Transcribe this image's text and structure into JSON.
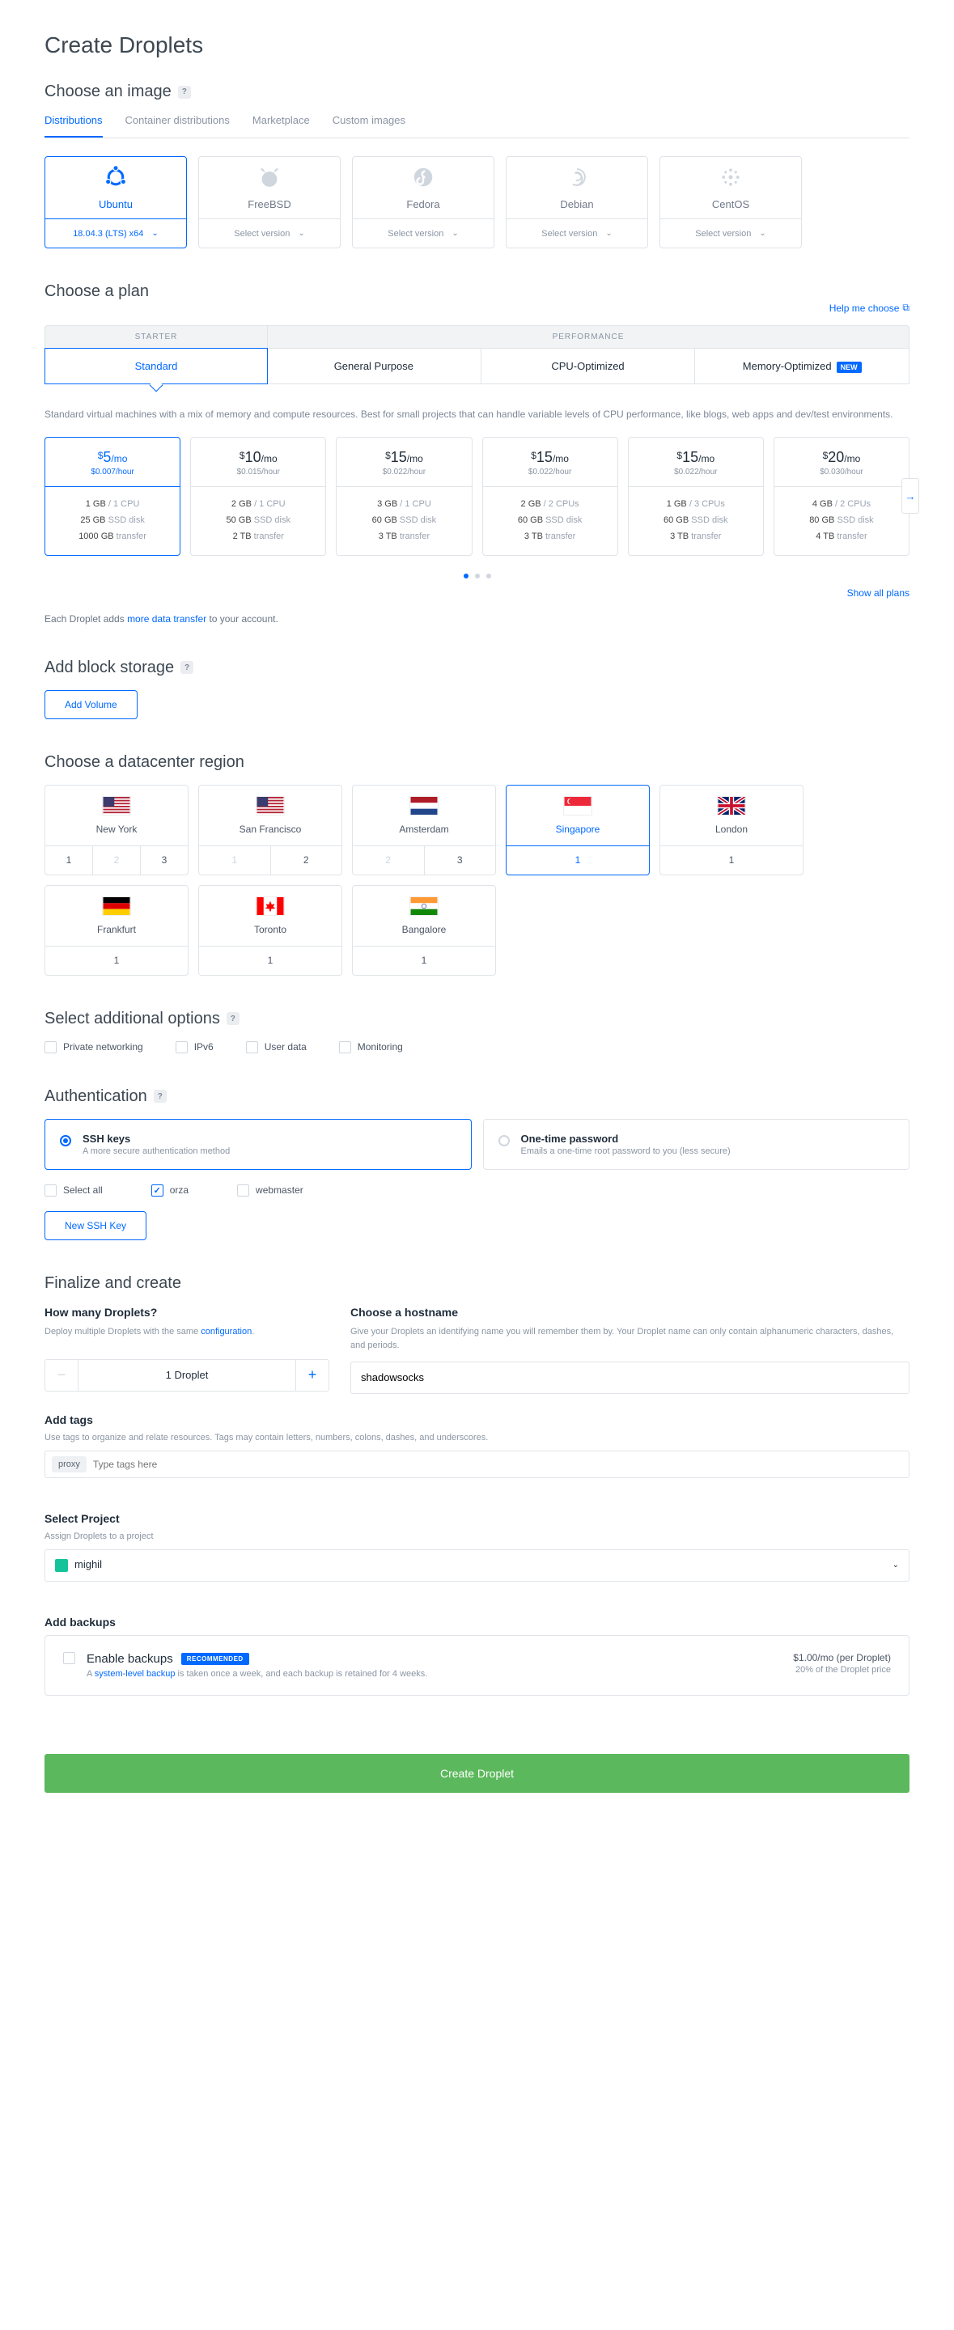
{
  "page_title": "Create Droplets",
  "image": {
    "heading": "Choose an image",
    "tabs": [
      "Distributions",
      "Container distributions",
      "Marketplace",
      "Custom images"
    ],
    "active_tab": 0,
    "distros": [
      {
        "name": "Ubuntu",
        "version": "18.04.3 (LTS) x64",
        "selected": true,
        "color": "#0069ff"
      },
      {
        "name": "FreeBSD",
        "version": "Select version",
        "selected": false,
        "color": "#cfd6de"
      },
      {
        "name": "Fedora",
        "version": "Select version",
        "selected": false,
        "color": "#cfd6de"
      },
      {
        "name": "Debian",
        "version": "Select version",
        "selected": false,
        "color": "#cfd6de"
      },
      {
        "name": "CentOS",
        "version": "Select version",
        "selected": false,
        "color": "#cfd6de"
      }
    ]
  },
  "plan": {
    "heading": "Choose a plan",
    "help_link": "Help me choose",
    "group_starter": "STARTER",
    "group_perf": "PERFORMANCE",
    "tabs": [
      "Standard",
      "General Purpose",
      "CPU-Optimized",
      "Memory-Optimized"
    ],
    "new_on": 3,
    "active_tab": 0,
    "desc": "Standard virtual machines with a mix of memory and compute resources. Best for small projects that can handle variable levels of CPU performance, like blogs, web apps and dev/test environments.",
    "prices": [
      {
        "mo": "5",
        "hr": "$0.007/hour",
        "ram": "1 GB",
        "cpu": "1 CPU",
        "disk": "25 GB",
        "xfer": "1000 GB",
        "selected": true
      },
      {
        "mo": "10",
        "hr": "$0.015/hour",
        "ram": "2 GB",
        "cpu": "1 CPU",
        "disk": "50 GB",
        "xfer": "2 TB",
        "selected": false
      },
      {
        "mo": "15",
        "hr": "$0.022/hour",
        "ram": "3 GB",
        "cpu": "1 CPU",
        "disk": "60 GB",
        "xfer": "3 TB",
        "selected": false
      },
      {
        "mo": "15",
        "hr": "$0.022/hour",
        "ram": "2 GB",
        "cpu": "2 CPUs",
        "disk": "60 GB",
        "xfer": "3 TB",
        "selected": false
      },
      {
        "mo": "15",
        "hr": "$0.022/hour",
        "ram": "1 GB",
        "cpu": "3 CPUs",
        "disk": "60 GB",
        "xfer": "3 TB",
        "selected": false
      },
      {
        "mo": "20",
        "hr": "$0.030/hour",
        "ram": "4 GB",
        "cpu": "2 CPUs",
        "disk": "80 GB",
        "xfer": "4 TB",
        "selected": false
      }
    ],
    "spec_labels": {
      "disk": "SSD disk",
      "xfer": "transfer",
      "mo_suffix": "/mo"
    },
    "show_all": "Show all plans",
    "note_prefix": "Each Droplet adds ",
    "note_link": "more data transfer",
    "note_suffix": " to your account."
  },
  "block": {
    "heading": "Add block storage",
    "button": "Add Volume"
  },
  "dc": {
    "heading": "Choose a datacenter region",
    "regions": [
      {
        "name": "New York",
        "flag": "us",
        "nums": [
          {
            "n": "1",
            "en": true
          },
          {
            "n": "2",
            "en": false
          },
          {
            "n": "3",
            "en": true
          }
        ],
        "selected": false
      },
      {
        "name": "San Francisco",
        "flag": "us",
        "nums": [
          {
            "n": "1",
            "en": false
          },
          {
            "n": "2",
            "en": true
          }
        ],
        "selected": false
      },
      {
        "name": "Amsterdam",
        "flag": "nl",
        "nums": [
          {
            "n": "2",
            "en": false
          },
          {
            "n": "3",
            "en": true
          }
        ],
        "selected": false
      },
      {
        "name": "Singapore",
        "flag": "sg",
        "nums": [
          {
            "n": "1",
            "en": true
          }
        ],
        "selected": true
      },
      {
        "name": "London",
        "flag": "uk",
        "nums": [
          {
            "n": "1",
            "en": true
          }
        ],
        "selected": false
      },
      {
        "name": "Frankfurt",
        "flag": "de",
        "nums": [
          {
            "n": "1",
            "en": true
          }
        ],
        "selected": false
      },
      {
        "name": "Toronto",
        "flag": "ca",
        "nums": [
          {
            "n": "1",
            "en": true
          }
        ],
        "selected": false
      },
      {
        "name": "Bangalore",
        "flag": "in",
        "nums": [
          {
            "n": "1",
            "en": true
          }
        ],
        "selected": false
      }
    ]
  },
  "opts": {
    "heading": "Select additional options",
    "items": [
      "Private networking",
      "IPv6",
      "User data",
      "Monitoring"
    ]
  },
  "auth": {
    "heading": "Authentication",
    "cards": [
      {
        "title": "SSH keys",
        "sub": "A more secure authentication method",
        "selected": true
      },
      {
        "title": "One-time password",
        "sub": "Emails a one-time root password to you (less secure)",
        "selected": false
      }
    ],
    "keys": [
      {
        "label": "Select all",
        "checked": false
      },
      {
        "label": "orza",
        "checked": true
      },
      {
        "label": "webmaster",
        "checked": false
      }
    ],
    "new_key": "New SSH Key"
  },
  "finalize": {
    "heading": "Finalize and create",
    "qty_title": "How many Droplets?",
    "qty_desc_1": "Deploy multiple Droplets with the same ",
    "qty_desc_link": "configuration",
    "qty_value": "1  Droplet",
    "host_title": "Choose a hostname",
    "host_desc": "Give your Droplets an identifying name you will remember them by. Your Droplet name can only contain alphanumeric characters, dashes, and periods.",
    "host_value": "shadowsocks"
  },
  "tags": {
    "heading": "Add tags",
    "desc": "Use tags to organize and relate resources. Tags may contain letters, numbers, colons, dashes, and underscores.",
    "chips": [
      "proxy"
    ],
    "placeholder": "Type tags here"
  },
  "project": {
    "heading": "Select Project",
    "desc": "Assign Droplets to a project",
    "value": "mighil"
  },
  "backups": {
    "heading": "Add backups",
    "enable": "Enable backups",
    "rec": "RECOMMENDED",
    "sub_1": "A ",
    "sub_link": "system-level backup",
    "sub_2": " is taken once a week, and each backup is retained for 4 weeks.",
    "price": "$1.00/mo (per Droplet)",
    "price_sub": "20% of the Droplet price"
  },
  "create_button": "Create Droplet"
}
